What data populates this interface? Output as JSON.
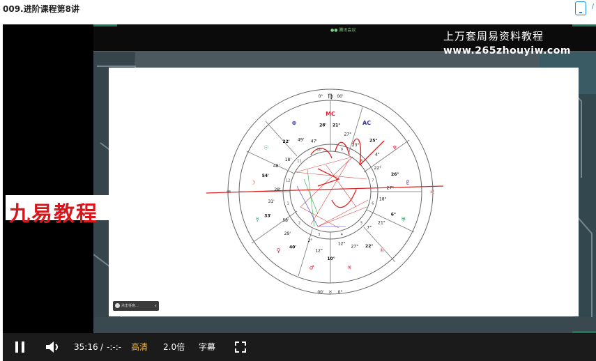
{
  "page": {
    "title": "009.进阶课程第8讲"
  },
  "watermark": {
    "line1": "上万套周易资料教程",
    "line2": "www.265zhouyiw.com",
    "tiny": "●● 腾讯会议"
  },
  "logo_overlay": {
    "text": "九易教程"
  },
  "slide": {
    "pill_label": "点击任意..."
  },
  "chart": {
    "top_glyph": "♍",
    "top_labels": [
      "0°",
      "00'"
    ],
    "bottom_labels": [
      "00'",
      "♉",
      "0°"
    ],
    "left_label": "♒",
    "right_label": "♌",
    "house_numbers": [
      "1",
      "2",
      "3",
      "4",
      "5",
      "6",
      "7",
      "8",
      "9",
      "10",
      "11",
      "12"
    ],
    "planet_labels": [
      {
        "text": "MC",
        "color": "#d23"
      },
      {
        "text": "AC",
        "color": "#33a"
      },
      {
        "text": "♆",
        "color": "#d23"
      },
      {
        "text": "♇",
        "color": "#228"
      },
      {
        "text": "♅",
        "color": "#2a6"
      },
      {
        "text": "♄",
        "color": "#d23"
      },
      {
        "text": "♃",
        "color": "#d23"
      },
      {
        "text": "♂",
        "color": "#d23"
      },
      {
        "text": "♀",
        "color": "#d23"
      },
      {
        "text": "☿",
        "color": "#2a6"
      },
      {
        "text": "☽",
        "color": "#d23"
      },
      {
        "text": "☉",
        "color": "#2a6"
      },
      {
        "text": "⊗",
        "color": "#33a"
      }
    ],
    "degree_labels": [
      "21°",
      "27°",
      "23°",
      "25°",
      "4°",
      "22°",
      "26°",
      "27°",
      "18°",
      "6°",
      "21°",
      "7°",
      "22°",
      "27°",
      "12°",
      "10°",
      "12°",
      "2°",
      "40'",
      "29'",
      "58'",
      "33'",
      "31'",
      "28'",
      "54'",
      "48'",
      "18'",
      "22'",
      "49'",
      "47'",
      "28'"
    ]
  },
  "controls": {
    "time_current": "35:16",
    "time_sep": "/",
    "time_total": "-:-:-",
    "quality": "高清",
    "speed": "2.0倍",
    "subtitle": "字幕"
  }
}
